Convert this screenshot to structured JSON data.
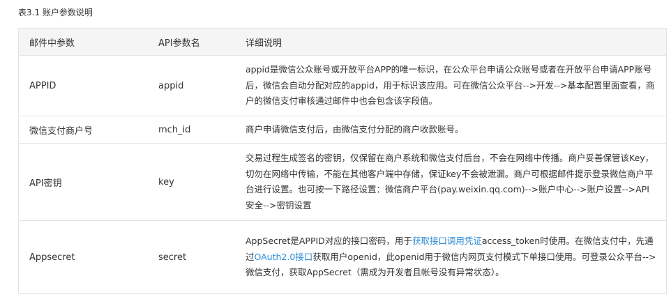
{
  "caption": "表3.1 账户参数说明",
  "headers": {
    "param": "邮件中参数",
    "api_name": "API参数名",
    "detail": "详细说明"
  },
  "rows": [
    {
      "param": "APPID",
      "api_name": "appid",
      "detail": "appid是微信公众账号或开放平台APP的唯一标识，在公众平台申请公众账号或者在开放平台申请APP账号后，微信会自动分配对应的appid，用于标识该应用。可在微信公众平台-->开发-->基本配置里面查看，商户的微信支付审核通过邮件中也会包含该字段值。"
    },
    {
      "param": "微信支付商户号",
      "api_name": "mch_id",
      "detail": "商户申请微信支付后，由微信支付分配的商户收款账号。"
    },
    {
      "param": "API密钥",
      "api_name": "key",
      "detail": "交易过程生成签名的密钥，仅保留在商户系统和微信支付后台，不会在网络中传播。商户妥善保管该Key，切勿在网络中传输，不能在其他客户端中存储，保证key不会被泄漏。商户可根据邮件提示登录微信商户平台进行设置。也可按一下路径设置：微信商户平台(pay.weixin.qq.com)-->账户中心-->账户设置-->API安全-->密钥设置"
    },
    {
      "param": "Appsecret",
      "api_name": "secret",
      "detail_parts": {
        "p1": "AppSecret是APPID对应的接口密码，用于",
        "link1": "获取接口调用凭证",
        "p2": "access_token时使用。在微信支付中，先通过",
        "link2": "OAuth2.0接口",
        "p3": "获取用户openid，此openid用于微信内网页支付模式下单接口使用。可登录公众平台-->微信支付，获取AppSecret（需成为开发者且帐号没有异常状态）。"
      }
    }
  ]
}
